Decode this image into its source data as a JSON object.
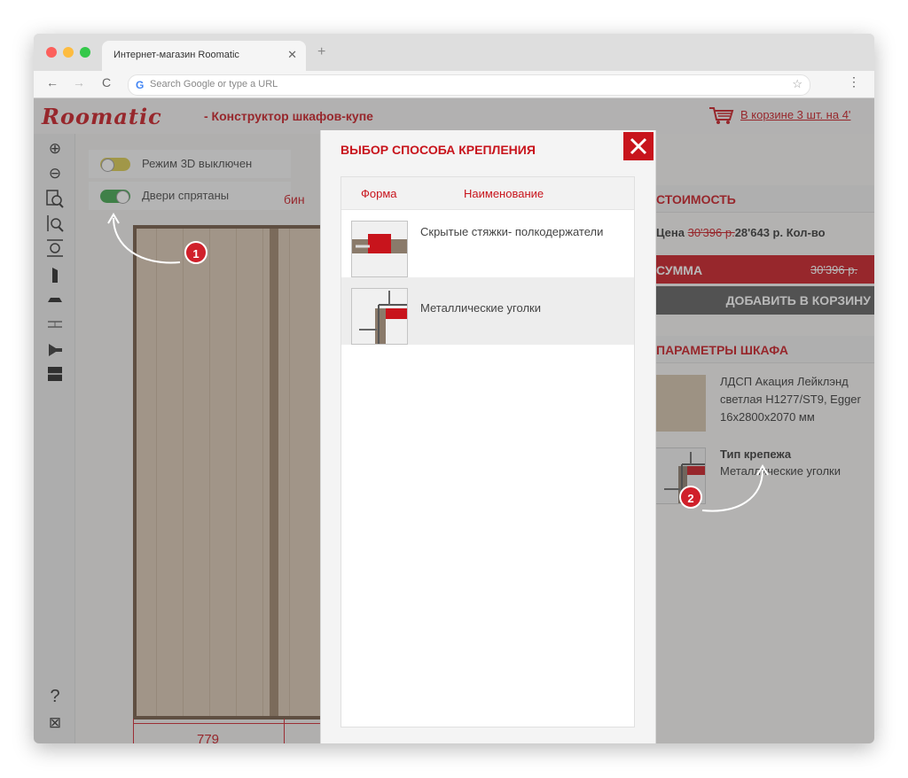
{
  "browser": {
    "tab_title": "Интернет-магазин Roomatic",
    "tab_close": "✕",
    "new_tab": "+",
    "back": "←",
    "forward": "→",
    "reload": "C",
    "omnibox_placeholder": "Search Google or type a URL",
    "bookmark": "☆",
    "menu": "⋮"
  },
  "header": {
    "logo": "Roomatic",
    "title": "- Конструктор шкафов-купе",
    "cart_link": "В корзине 3 шт. на 4'"
  },
  "toggles": [
    {
      "label": "Режим 3D выключен",
      "state": "off",
      "color": "#d9c84a"
    },
    {
      "label": "Двери спрятаны",
      "state": "on",
      "color": "#3aa34a"
    }
  ],
  "canvas": {
    "width_label": "779",
    "partial_label": "бин"
  },
  "right_panel": {
    "cost_heading": "СТОИМОСТЬ",
    "price_label": "Цена",
    "price_old": "30'396 р.",
    "price_new": "28'643 р.",
    "qty_label": "Кол-во",
    "sum_label": "СУММА",
    "sum_old": "30'396 р.",
    "add_to_cart": "ДОБАВИТЬ В КОРЗИНУ",
    "params_heading": "ПАРАМЕТРЫ ШКАФА",
    "material_text": "ЛДСП Акация Лейклэнд светлая H1277/ST9, Egger 16x2800x2070 мм",
    "mount_label": "Тип крепежа",
    "mount_value": "Металлические уголки"
  },
  "modal": {
    "title": "ВЫБОР СПОСОБА КРЕПЛЕНИЯ",
    "close": "✕",
    "col_shape": "Форма",
    "col_name": "Наименование",
    "options": [
      {
        "name": "Скрытые стяжки- полкодержатели",
        "selected": false
      },
      {
        "name": "Металлические уголки",
        "selected": true
      }
    ]
  },
  "annotations": {
    "badge_1": "1",
    "badge_2": "2"
  },
  "colors": {
    "accent": "#c8141c",
    "dark_button": "#5a5a5a"
  }
}
